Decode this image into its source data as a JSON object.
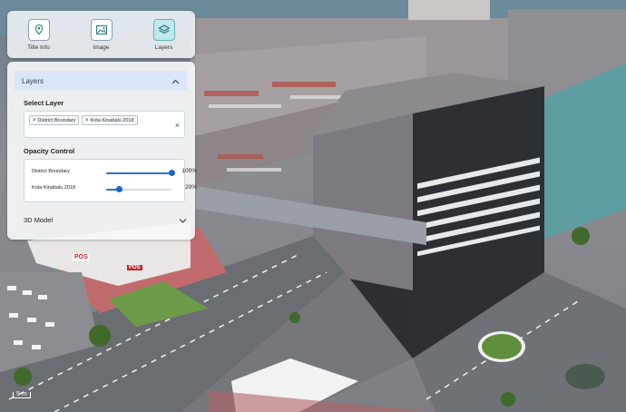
{
  "toolbar": {
    "items": [
      {
        "label": "Title Info",
        "icon": "map-pin-icon",
        "active": false
      },
      {
        "label": "Image",
        "icon": "image-icon",
        "active": false
      },
      {
        "label": "Layers",
        "icon": "layers-icon",
        "active": true
      }
    ]
  },
  "layers_panel": {
    "header": "Layers",
    "select_layer": {
      "title": "Select Layer",
      "chips": [
        "District Boundary",
        "Kota Kinabalu 2018"
      ]
    },
    "opacity": {
      "title": "Opacity Control",
      "rows": [
        {
          "name": "District Boundary",
          "value": 100,
          "value_label": "100%"
        },
        {
          "name": "Kota Kinabalu 2018",
          "value": 20,
          "value_label": "20%"
        }
      ]
    },
    "footer": "3D Model"
  },
  "map": {
    "scale_label": "5 m",
    "signs": [
      "POS",
      "POS"
    ]
  },
  "colors": {
    "accent": "#1e63cf",
    "panel_header": "#dbe7f9",
    "active_tool": "#bfe9ea"
  }
}
